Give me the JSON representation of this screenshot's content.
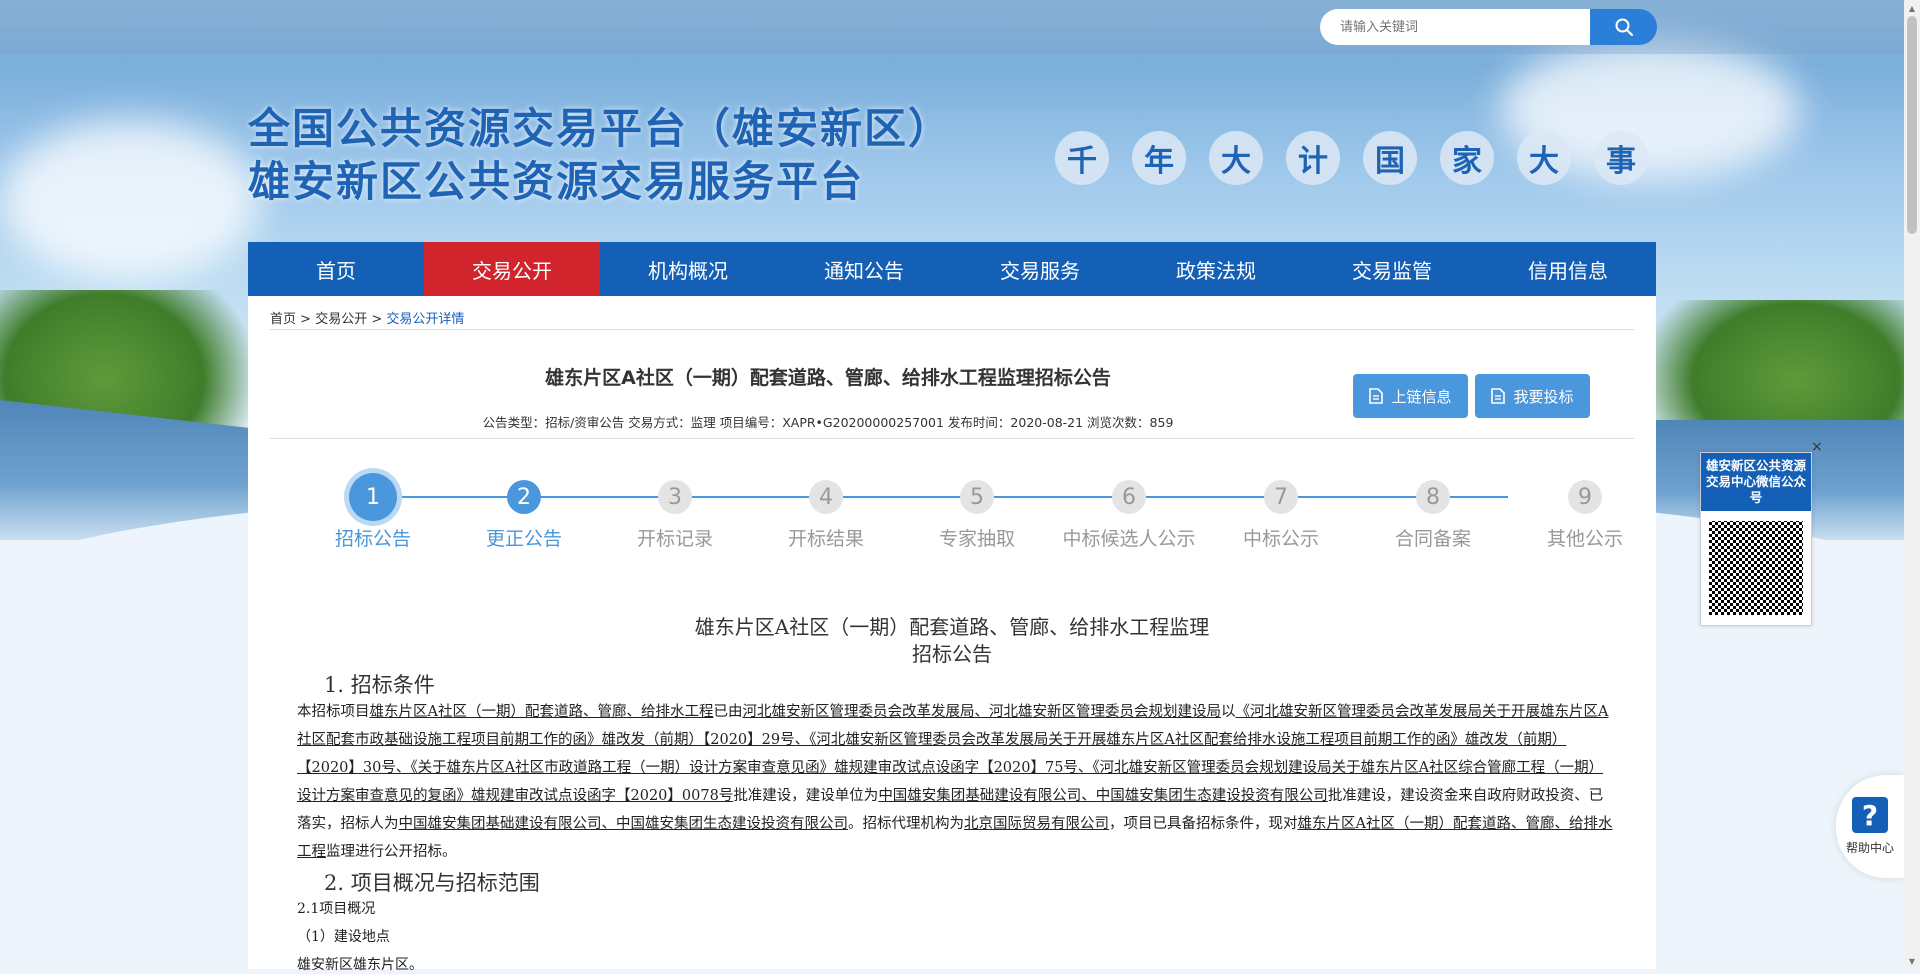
{
  "search": {
    "placeholder": "请输入关键词"
  },
  "header": {
    "title_line1": "全国公共资源交易平台（雄安新区）",
    "title_line2": "雄安新区公共资源交易服务平台",
    "slogan": [
      "千",
      "年",
      "大",
      "计",
      "国",
      "家",
      "大",
      "事"
    ]
  },
  "nav": {
    "items": [
      {
        "label": "首页"
      },
      {
        "label": "交易公开",
        "active": true
      },
      {
        "label": "机构概况"
      },
      {
        "label": "通知公告"
      },
      {
        "label": "交易服务"
      },
      {
        "label": "政策法规"
      },
      {
        "label": "交易监管"
      },
      {
        "label": "信用信息"
      }
    ]
  },
  "breadcrumb": {
    "home": "首页",
    "sep": ">",
    "section": "交易公开",
    "current": "交易公开详情"
  },
  "article": {
    "title": "雄东片区A社区（一期）配套道路、管廊、给排水工程监理招标公告",
    "meta": "公告类型：招标/资审公告 交易方式：监理 项目编号：XAPR•G20200000257001 发布时间：2020-08-21 浏览次数：859",
    "btn_chain": "上链信息",
    "btn_bid": "我要投标"
  },
  "steps": [
    {
      "num": "1",
      "label": "招标公告",
      "state": "current"
    },
    {
      "num": "2",
      "label": "更正公告",
      "state": "done"
    },
    {
      "num": "3",
      "label": "开标记录",
      "state": "todo"
    },
    {
      "num": "4",
      "label": "开标结果",
      "state": "todo"
    },
    {
      "num": "5",
      "label": "专家抽取",
      "state": "todo"
    },
    {
      "num": "6",
      "label": "中标候选人公示",
      "state": "todo"
    },
    {
      "num": "7",
      "label": "中标公示",
      "state": "todo"
    },
    {
      "num": "8",
      "label": "合同备案",
      "state": "todo"
    },
    {
      "num": "9",
      "label": "其他公示",
      "state": "todo"
    }
  ],
  "doc": {
    "title_line1": "雄东片区A社区（一期）配套道路、管廊、给排水工程监理",
    "title_line2": "招标公告",
    "h1": "1.  招标条件",
    "p1_a": "本招标项目",
    "p1_u1": "雄东片区A社区（一期）配套道路、管廊、给排水工程",
    "p1_b": "已由",
    "p1_u2": "河北雄安新区管理委员会改革发展局、河北雄安新区管理委员会规划建设局",
    "p1_c": "以",
    "p1_u3": "《河北雄安新区管理委员会改革发展局关于开展雄东片区A社区配套市政基础设施工程项目前期工作的函》雄改发（前期）【2020】29号、《河北雄安新区管理委员会改革发展局关于开展雄东片区A社区配套给排水设施工程项目前期工作的函》雄改发（前期）【2020】30号、《关于雄东片区A社区市政道路工程（一期）设计方案审查意见函》雄规建审改试点设函字【2020】75号、《河北雄安新区管理委员会规划建设局关于雄东片区A社区综合管廊工程（一期）设计方案审查意见的复函》雄规建审改试点设函字【2020】0078号",
    "p1_d": "批准建设，建设单位为",
    "p1_u4": "中国雄安集团基础建设有限公司、中国雄安集团生态建设投资有限公司",
    "p1_e": "批准建设，建设资金来自政府财政投资、已落实，招标人为",
    "p1_u5": "中国雄安集团基础建设有限公司、中国雄安集团生态建设投资有限公司",
    "p1_f": "。招标代理机构为",
    "p1_u6": "北京国际贸易有限公司",
    "p1_g": "，项目已具备招标条件，现对",
    "p1_u7": "雄东片区A社区（一期）配套道路、管廊、给排水工程",
    "p1_h": "监理进行公开招标。",
    "h2": "2.  项目概况与招标范围",
    "s21": "2.1项目概况",
    "s21a": "（1）建设地点",
    "s21a_v": "雄安新区雄东片区。"
  },
  "qr": {
    "title": "雄安新区公共资源交易中心微信公众号",
    "close": "×"
  },
  "help": {
    "label": "帮助中心",
    "icon": "?"
  }
}
